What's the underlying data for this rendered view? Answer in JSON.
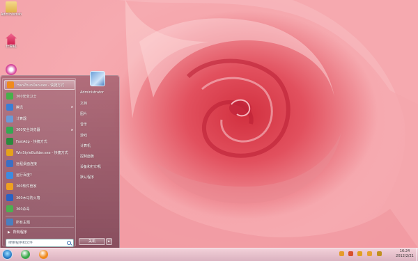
{
  "desktop": {
    "icons": [
      {
        "label": "Administrator",
        "icon": "folder-icon",
        "color": "#e9c15a"
      },
      {
        "label": "计算机",
        "icon": "home-icon",
        "color": "#e23b6e"
      },
      {
        "label": "",
        "icon": "app-icon",
        "color": "#d64a9c"
      }
    ]
  },
  "start_menu": {
    "programs": [
      {
        "label": "HanZhuoDao.exe - 快捷方式",
        "icon": "app-orange-icon",
        "color": "#f08a1c",
        "highlighted": true,
        "submenu": false
      },
      {
        "label": "360安全卫士",
        "icon": "shield-icon",
        "color": "#47b04a",
        "highlighted": false,
        "submenu": false
      },
      {
        "label": "腾讯",
        "icon": "qq-icon",
        "color": "#3b7ed6",
        "highlighted": false,
        "submenu": true
      },
      {
        "label": "计算器",
        "icon": "calculator-icon",
        "color": "#6a9ad6",
        "highlighted": false,
        "submenu": false
      },
      {
        "label": "360安全浏览器",
        "icon": "browser-icon",
        "color": "#34a853",
        "highlighted": false,
        "submenu": true
      },
      {
        "label": "FastAdp - 快捷方式",
        "icon": "fastadp-icon",
        "color": "#2b8a3e",
        "highlighted": false,
        "submenu": false
      },
      {
        "label": "WinStyleBuilder.exe - 快捷方式",
        "icon": "winstyle-icon",
        "color": "#e6a21a",
        "highlighted": false,
        "submenu": false
      },
      {
        "label": "远程桌面连接",
        "icon": "remote-desktop-icon",
        "color": "#3c6fc4",
        "highlighted": false,
        "submenu": false
      },
      {
        "label": "运行百度?",
        "icon": "run-icon",
        "color": "#3e8be0",
        "highlighted": false,
        "submenu": false
      },
      {
        "label": "360软件管家",
        "icon": "software-manager-icon",
        "color": "#f0a020",
        "highlighted": false,
        "submenu": false
      },
      {
        "label": "360木马防火墙",
        "icon": "firewall-icon",
        "color": "#2a62c4",
        "highlighted": false,
        "submenu": false
      },
      {
        "label": "360杀毒",
        "icon": "antivirus-icon",
        "color": "#4caf50",
        "highlighted": false,
        "submenu": false
      }
    ],
    "pinned_bottom": {
      "label": "所有主题",
      "icon": "theme-icon",
      "color": "#4a7fbf"
    },
    "all_programs": "所有程序",
    "search_placeholder": "搜索程序和文件",
    "right_items": [
      "Administrator",
      "文档",
      "图片",
      "音乐",
      "游戏",
      "计算机",
      "控制面板",
      "设备和打印机",
      "默认程序"
    ],
    "shutdown_label": "关机"
  },
  "taskbar": {
    "pinned": [
      {
        "icon": "browser-pin-icon",
        "color": "#3aa84a"
      },
      {
        "icon": "app-pin-icon",
        "color": "#f08a1c"
      }
    ],
    "tray": [
      {
        "icon": "tray-app-icon",
        "color": "#e59b2a"
      },
      {
        "icon": "tray-shield-icon",
        "color": "#d8502c"
      },
      {
        "icon": "tray-flag-icon",
        "color": "#e0a020"
      },
      {
        "icon": "tray-network-icon",
        "color": "#e5a030"
      },
      {
        "icon": "tray-volume-icon",
        "color": "#c09020"
      }
    ],
    "clock_time": "16:24",
    "clock_date": "2012/2/21"
  }
}
